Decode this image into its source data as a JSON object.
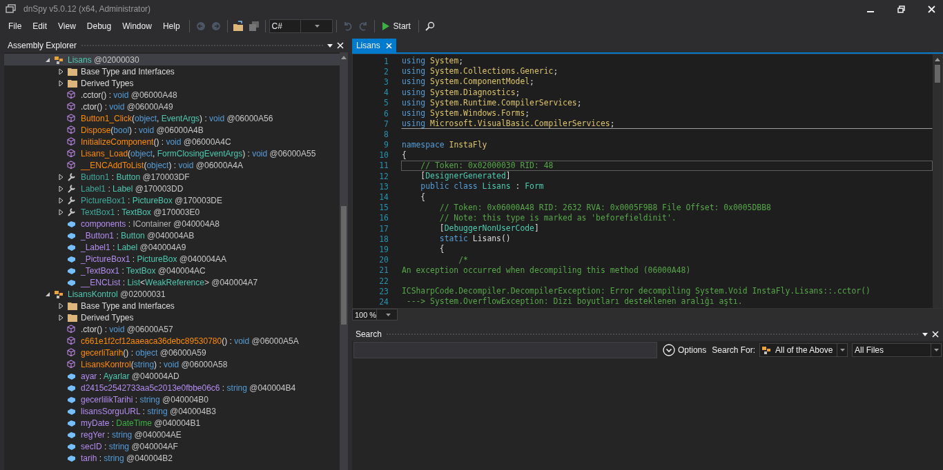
{
  "window": {
    "title": "dnSpy v5.0.12 (x64, Administrator)"
  },
  "menu": [
    "File",
    "Edit",
    "View",
    "Debug",
    "Window",
    "Help"
  ],
  "toolbar": {
    "language": "C#",
    "start": "Start"
  },
  "assembly_explorer": {
    "title": "Assembly Explorer",
    "tree": [
      {
        "kind": "class",
        "selected": true,
        "expanded": true,
        "label": [
          {
            "text": "Lisans",
            "kind": "class"
          },
          {
            "text": " @02000030",
            "kind": "token"
          }
        ],
        "children": [
          {
            "kind": "folder",
            "selected": false,
            "expanded": false,
            "label": [
              {
                "text": "Base Type and Interfaces",
                "kind": "plain"
              }
            ]
          },
          {
            "kind": "folder",
            "selected": false,
            "expanded": false,
            "label": [
              {
                "text": "Derived Types",
                "kind": "plain"
              }
            ]
          },
          {
            "kind": "method",
            "selected": false,
            "label": [
              {
                "text": ".cctor()",
                "kind": "plain"
              },
              {
                "text": " : ",
                "kind": "plain"
              },
              {
                "text": "void",
                "kind": "keyword"
              },
              {
                "text": " @06000A48",
                "kind": "token"
              }
            ]
          },
          {
            "kind": "method",
            "selected": false,
            "label": [
              {
                "text": ".ctor()",
                "kind": "plain"
              },
              {
                "text": " : ",
                "kind": "plain"
              },
              {
                "text": "void",
                "kind": "keyword"
              },
              {
                "text": " @06000A49",
                "kind": "token"
              }
            ]
          },
          {
            "kind": "method",
            "selected": false,
            "label": [
              {
                "text": "Button1_Click",
                "kind": "method"
              },
              {
                "text": "(",
                "kind": "plain"
              },
              {
                "text": "object",
                "kind": "keyword"
              },
              {
                "text": ", ",
                "kind": "plain"
              },
              {
                "text": "EventArgs",
                "kind": "type"
              },
              {
                "text": ") : ",
                "kind": "plain"
              },
              {
                "text": "void",
                "kind": "keyword"
              },
              {
                "text": " @06000A56",
                "kind": "token"
              }
            ]
          },
          {
            "kind": "method",
            "selected": false,
            "label": [
              {
                "text": "Dispose",
                "kind": "method"
              },
              {
                "text": "(",
                "kind": "plain"
              },
              {
                "text": "bool",
                "kind": "keyword"
              },
              {
                "text": ") : ",
                "kind": "plain"
              },
              {
                "text": "void",
                "kind": "keyword"
              },
              {
                "text": " @06000A4B",
                "kind": "token"
              }
            ]
          },
          {
            "kind": "method",
            "selected": false,
            "label": [
              {
                "text": "InitializeComponent",
                "kind": "method"
              },
              {
                "text": "() : ",
                "kind": "plain"
              },
              {
                "text": "void",
                "kind": "keyword"
              },
              {
                "text": " @06000A4C",
                "kind": "token"
              }
            ]
          },
          {
            "kind": "method",
            "selected": false,
            "label": [
              {
                "text": "Lisans_Load",
                "kind": "method"
              },
              {
                "text": "(",
                "kind": "plain"
              },
              {
                "text": "object",
                "kind": "keyword"
              },
              {
                "text": ", ",
                "kind": "plain"
              },
              {
                "text": "FormClosingEventArgs",
                "kind": "type"
              },
              {
                "text": ") : ",
                "kind": "plain"
              },
              {
                "text": "void",
                "kind": "keyword"
              },
              {
                "text": " @06000A55",
                "kind": "token"
              }
            ]
          },
          {
            "kind": "method",
            "selected": false,
            "label": [
              {
                "text": "__ENCAddToList",
                "kind": "method"
              },
              {
                "text": "(",
                "kind": "plain"
              },
              {
                "text": "object",
                "kind": "keyword"
              },
              {
                "text": ") : ",
                "kind": "plain"
              },
              {
                "text": "void",
                "kind": "keyword"
              },
              {
                "text": " @06000A4A",
                "kind": "token"
              }
            ]
          },
          {
            "kind": "property",
            "selected": false,
            "expanded": false,
            "label": [
              {
                "text": "Button1",
                "kind": "property"
              },
              {
                "text": " : ",
                "kind": "plain"
              },
              {
                "text": "Button",
                "kind": "type"
              },
              {
                "text": " @170003DF",
                "kind": "token"
              }
            ]
          },
          {
            "kind": "property",
            "selected": false,
            "expanded": false,
            "label": [
              {
                "text": "Label1",
                "kind": "property"
              },
              {
                "text": " : ",
                "kind": "plain"
              },
              {
                "text": "Label",
                "kind": "type"
              },
              {
                "text": " @170003DD",
                "kind": "token"
              }
            ]
          },
          {
            "kind": "property",
            "selected": false,
            "expanded": false,
            "label": [
              {
                "text": "PictureBox1",
                "kind": "property"
              },
              {
                "text": " : ",
                "kind": "plain"
              },
              {
                "text": "PictureBox",
                "kind": "type"
              },
              {
                "text": " @170003DE",
                "kind": "token"
              }
            ]
          },
          {
            "kind": "property",
            "selected": false,
            "expanded": false,
            "label": [
              {
                "text": "TextBox1",
                "kind": "property"
              },
              {
                "text": " : ",
                "kind": "plain"
              },
              {
                "text": "TextBox",
                "kind": "type"
              },
              {
                "text": " @170003E0",
                "kind": "token"
              }
            ]
          },
          {
            "kind": "field",
            "selected": false,
            "label": [
              {
                "text": "components",
                "kind": "field"
              },
              {
                "text": " : ",
                "kind": "plain"
              },
              {
                "text": "IContainer",
                "kind": "interface"
              },
              {
                "text": " @040004A8",
                "kind": "token"
              }
            ]
          },
          {
            "kind": "field",
            "selected": false,
            "label": [
              {
                "text": "_Button1",
                "kind": "field"
              },
              {
                "text": " : ",
                "kind": "plain"
              },
              {
                "text": "Button",
                "kind": "type"
              },
              {
                "text": " @040004AB",
                "kind": "token"
              }
            ]
          },
          {
            "kind": "field",
            "selected": false,
            "label": [
              {
                "text": "_Label1",
                "kind": "field"
              },
              {
                "text": " : ",
                "kind": "plain"
              },
              {
                "text": "Label",
                "kind": "type"
              },
              {
                "text": " @040004A9",
                "kind": "token"
              }
            ]
          },
          {
            "kind": "field",
            "selected": false,
            "label": [
              {
                "text": "_PictureBox1",
                "kind": "field"
              },
              {
                "text": " : ",
                "kind": "plain"
              },
              {
                "text": "PictureBox",
                "kind": "type"
              },
              {
                "text": " @040004AA",
                "kind": "token"
              }
            ]
          },
          {
            "kind": "field",
            "selected": false,
            "label": [
              {
                "text": "_TextBox1",
                "kind": "field"
              },
              {
                "text": " : ",
                "kind": "plain"
              },
              {
                "text": "TextBox",
                "kind": "type"
              },
              {
                "text": " @040004AC",
                "kind": "token"
              }
            ]
          },
          {
            "kind": "field",
            "selected": false,
            "label": [
              {
                "text": "__ENCList",
                "kind": "field"
              },
              {
                "text": " : ",
                "kind": "plain"
              },
              {
                "text": "List",
                "kind": "type"
              },
              {
                "text": "<",
                "kind": "plain"
              },
              {
                "text": "WeakReference",
                "kind": "type"
              },
              {
                "text": "> @040004A7",
                "kind": "token"
              }
            ]
          }
        ]
      },
      {
        "kind": "class",
        "selected": false,
        "expanded": true,
        "label": [
          {
            "text": "LisansKontrol",
            "kind": "class"
          },
          {
            "text": " @02000031",
            "kind": "token"
          }
        ],
        "children": [
          {
            "kind": "folder",
            "selected": false,
            "expanded": false,
            "label": [
              {
                "text": "Base Type and Interfaces",
                "kind": "plain"
              }
            ]
          },
          {
            "kind": "folder",
            "selected": false,
            "expanded": false,
            "label": [
              {
                "text": "Derived Types",
                "kind": "plain"
              }
            ]
          },
          {
            "kind": "method",
            "selected": false,
            "label": [
              {
                "text": ".ctor()",
                "kind": "plain"
              },
              {
                "text": " : ",
                "kind": "plain"
              },
              {
                "text": "void",
                "kind": "keyword"
              },
              {
                "text": " @06000A57",
                "kind": "token"
              }
            ]
          },
          {
            "kind": "method",
            "selected": false,
            "label": [
              {
                "text": "c661e1f2cf12aaeaca36debc89530780",
                "kind": "method"
              },
              {
                "text": "() : ",
                "kind": "plain"
              },
              {
                "text": "void",
                "kind": "keyword"
              },
              {
                "text": " @06000A5A",
                "kind": "token"
              }
            ]
          },
          {
            "kind": "method",
            "selected": false,
            "label": [
              {
                "text": "gecerliTarih",
                "kind": "method"
              },
              {
                "text": "() : ",
                "kind": "plain"
              },
              {
                "text": "object",
                "kind": "keyword"
              },
              {
                "text": " @06000A59",
                "kind": "token"
              }
            ]
          },
          {
            "kind": "method",
            "selected": false,
            "label": [
              {
                "text": "LisansKontrol",
                "kind": "method"
              },
              {
                "text": "(",
                "kind": "plain"
              },
              {
                "text": "string",
                "kind": "keyword"
              },
              {
                "text": ") : ",
                "kind": "plain"
              },
              {
                "text": "void",
                "kind": "keyword"
              },
              {
                "text": " @06000A58",
                "kind": "token"
              }
            ]
          },
          {
            "kind": "field",
            "selected": false,
            "label": [
              {
                "text": "ayar",
                "kind": "field"
              },
              {
                "text": " : ",
                "kind": "plain"
              },
              {
                "text": "Ayarlar",
                "kind": "type"
              },
              {
                "text": " @040004AD",
                "kind": "token"
              }
            ]
          },
          {
            "kind": "field",
            "selected": false,
            "label": [
              {
                "text": "d2415c2542733aa5c2013e0fbbe06c6",
                "kind": "field"
              },
              {
                "text": " : ",
                "kind": "plain"
              },
              {
                "text": "string",
                "kind": "keyword"
              },
              {
                "text": " @040004B4",
                "kind": "token"
              }
            ]
          },
          {
            "kind": "field",
            "selected": false,
            "label": [
              {
                "text": "gecerlilikTarihi",
                "kind": "field"
              },
              {
                "text": " : ",
                "kind": "plain"
              },
              {
                "text": "string",
                "kind": "keyword"
              },
              {
                "text": " @040004B0",
                "kind": "token"
              }
            ]
          },
          {
            "kind": "field",
            "selected": false,
            "label": [
              {
                "text": "lisansSorguURL",
                "kind": "field"
              },
              {
                "text": " : ",
                "kind": "plain"
              },
              {
                "text": "string",
                "kind": "keyword"
              },
              {
                "text": " @040004B3",
                "kind": "token"
              }
            ]
          },
          {
            "kind": "field",
            "selected": false,
            "label": [
              {
                "text": "myDate",
                "kind": "field"
              },
              {
                "text": " : ",
                "kind": "plain"
              },
              {
                "text": "DateTime",
                "kind": "valuetype"
              },
              {
                "text": " @040004B1",
                "kind": "token"
              }
            ]
          },
          {
            "kind": "field",
            "selected": false,
            "label": [
              {
                "text": "regYer",
                "kind": "field"
              },
              {
                "text": " : ",
                "kind": "plain"
              },
              {
                "text": "string",
                "kind": "keyword"
              },
              {
                "text": " @040004AE",
                "kind": "token"
              }
            ]
          },
          {
            "kind": "field",
            "selected": false,
            "label": [
              {
                "text": "secID",
                "kind": "field"
              },
              {
                "text": " : ",
                "kind": "plain"
              },
              {
                "text": "string",
                "kind": "keyword"
              },
              {
                "text": " @040004AF",
                "kind": "token"
              }
            ]
          },
          {
            "kind": "field",
            "selected": false,
            "label": [
              {
                "text": "tarih",
                "kind": "field"
              },
              {
                "text": " : ",
                "kind": "plain"
              },
              {
                "text": "string",
                "kind": "keyword"
              },
              {
                "text": " @040004B2",
                "kind": "token"
              }
            ]
          }
        ]
      }
    ]
  },
  "editor": {
    "tabs": [
      {
        "label": "Lisans",
        "selected": true
      }
    ],
    "zoom": "100 %",
    "lines": [
      {
        "number": "1",
        "current": false,
        "segments": [
          {
            "text": "using",
            "kind": "keyword"
          },
          {
            "text": " System",
            "kind": "namespace"
          },
          {
            "text": ";",
            "kind": "plain"
          }
        ]
      },
      {
        "number": "2",
        "current": false,
        "segments": [
          {
            "text": "using",
            "kind": "keyword"
          },
          {
            "text": " System.Collections.Generic",
            "kind": "namespace"
          },
          {
            "text": ";",
            "kind": "plain"
          }
        ]
      },
      {
        "number": "3",
        "current": false,
        "segments": [
          {
            "text": "using",
            "kind": "keyword"
          },
          {
            "text": " System.ComponentModel",
            "kind": "namespace"
          },
          {
            "text": ";",
            "kind": "plain"
          }
        ]
      },
      {
        "number": "4",
        "current": false,
        "segments": [
          {
            "text": "using",
            "kind": "keyword"
          },
          {
            "text": " System.Diagnostics",
            "kind": "namespace"
          },
          {
            "text": ";",
            "kind": "plain"
          }
        ]
      },
      {
        "number": "5",
        "current": false,
        "segments": [
          {
            "text": "using",
            "kind": "keyword"
          },
          {
            "text": " System.Runtime.CompilerServices",
            "kind": "namespace"
          },
          {
            "text": ";",
            "kind": "plain"
          }
        ]
      },
      {
        "number": "6",
        "current": false,
        "segments": [
          {
            "text": "using",
            "kind": "keyword"
          },
          {
            "text": " System.Windows.Forms",
            "kind": "namespace"
          },
          {
            "text": ";",
            "kind": "plain"
          }
        ]
      },
      {
        "number": "7",
        "current": false,
        "separator": true,
        "segments": [
          {
            "text": "using",
            "kind": "keyword"
          },
          {
            "text": " Microsoft.VisualBasic.CompilerServices",
            "kind": "namespace"
          },
          {
            "text": ";",
            "kind": "plain"
          }
        ]
      },
      {
        "number": "8",
        "current": false
      },
      {
        "number": "9",
        "current": false,
        "segments": [
          {
            "text": "namespace",
            "kind": "keyword"
          },
          {
            "text": " InstaFly",
            "kind": "namespace"
          }
        ]
      },
      {
        "number": "10",
        "current": false,
        "segments": [
          {
            "text": "{",
            "kind": "plain"
          }
        ]
      },
      {
        "number": "11",
        "current": true,
        "segments": [
          {
            "text": "    // Token: 0x02000030 RID: 48",
            "kind": "comment"
          }
        ]
      },
      {
        "number": "12",
        "current": false,
        "segments": [
          {
            "text": "    [",
            "kind": "plain"
          },
          {
            "text": "DesignerGenerated",
            "kind": "type"
          },
          {
            "text": "]",
            "kind": "plain"
          }
        ]
      },
      {
        "number": "13",
        "current": false,
        "segments": [
          {
            "text": "    public",
            "kind": "keyword"
          },
          {
            "text": " class",
            "kind": "keyword"
          },
          {
            "text": " Lisans",
            "kind": "type"
          },
          {
            "text": " : ",
            "kind": "plain"
          },
          {
            "text": "Form",
            "kind": "type"
          }
        ]
      },
      {
        "number": "14",
        "current": false,
        "segments": [
          {
            "text": "    {",
            "kind": "plain"
          }
        ]
      },
      {
        "number": "15",
        "current": false,
        "segments": [
          {
            "text": "        // Token: 0x06000A48 RID: 2632 RVA: 0x0005F9B8 File Offset: 0x0005DBB8",
            "kind": "comment"
          }
        ]
      },
      {
        "number": "16",
        "current": false,
        "segments": [
          {
            "text": "        // Note: this type is marked as 'beforefieldinit'.",
            "kind": "comment"
          }
        ]
      },
      {
        "number": "17",
        "current": false,
        "segments": [
          {
            "text": "        [",
            "kind": "plain"
          },
          {
            "text": "DebuggerNonUserCode",
            "kind": "type"
          },
          {
            "text": "]",
            "kind": "plain"
          }
        ]
      },
      {
        "number": "18",
        "current": false,
        "segments": [
          {
            "text": "        static",
            "kind": "keyword"
          },
          {
            "text": " Lisans()",
            "kind": "plain"
          }
        ]
      },
      {
        "number": "19",
        "current": false,
        "segments": [
          {
            "text": "        {",
            "kind": "plain"
          }
        ]
      },
      {
        "number": "20",
        "current": false,
        "segments": [
          {
            "text": "            /*",
            "kind": "comment"
          }
        ]
      },
      {
        "number": "21",
        "current": false,
        "segments": [
          {
            "text": "An exception occurred when decompiling this method (06000A48)",
            "kind": "comment"
          }
        ]
      },
      {
        "number": "22",
        "current": false
      },
      {
        "number": "23",
        "current": false,
        "segments": [
          {
            "text": "ICSharpCode.Decompiler.DecompilerException: Error decompiling System.Void InstaFly.Lisans::.cctor()",
            "kind": "comment"
          }
        ]
      },
      {
        "number": "24",
        "current": false,
        "segments": [
          {
            "text": " ---> System.OverflowException: Dizi boyutları desteklenen aralığı aştı.",
            "kind": "comment"
          }
        ]
      }
    ]
  },
  "search": {
    "title": "Search",
    "options": "Options",
    "search_for_label": "Search For:",
    "search_for": "All of the Above",
    "scope": "All Files"
  }
}
